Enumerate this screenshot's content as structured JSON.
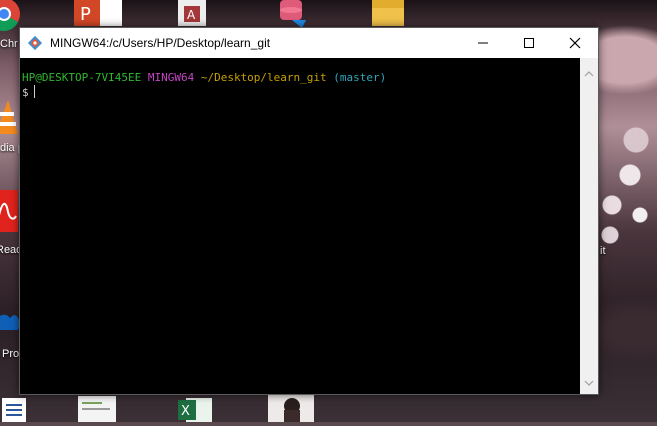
{
  "desktop": {
    "icons": [
      {
        "name": "chrome",
        "label": "Chr"
      },
      {
        "name": "powerpoint",
        "label": ""
      },
      {
        "name": "access",
        "label": ""
      },
      {
        "name": "database",
        "label": ""
      },
      {
        "name": "folder",
        "label": ""
      },
      {
        "name": "vlc",
        "label": "dia p"
      },
      {
        "name": "acrobat-reader",
        "label": "Read"
      },
      {
        "name": "onedrive",
        "label": "Pro"
      },
      {
        "name": "document",
        "label": ""
      },
      {
        "name": "notepad",
        "label": ""
      },
      {
        "name": "excel",
        "label": ""
      },
      {
        "name": "photo",
        "label": ""
      }
    ],
    "right_label": "it"
  },
  "window": {
    "title": "MINGW64:/c/Users/HP/Desktop/learn_git",
    "minimize_symbol": "—",
    "maximize_symbol": "☐",
    "close_symbol": "✕"
  },
  "terminal": {
    "user_host": "HP@DESKTOP-7VI45EE",
    "system": "MINGW64",
    "path": "~/Desktop/learn_git",
    "branch": "(master)",
    "prompt": "$"
  },
  "colors": {
    "user_host": "#2fb82f",
    "system": "#c445c4",
    "path": "#c4a000",
    "branch": "#2ea6b8"
  }
}
